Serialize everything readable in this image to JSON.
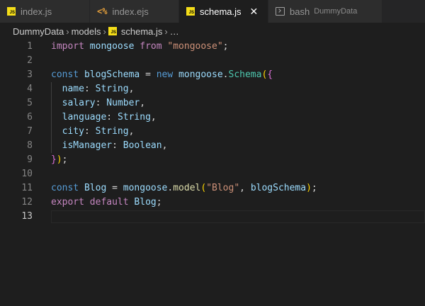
{
  "tabs": [
    {
      "label": "index.js",
      "icon": "js-icon"
    },
    {
      "label": "index.ejs",
      "icon": "ejs-icon"
    },
    {
      "label": "schema.js",
      "icon": "js-icon",
      "active": true,
      "close": "✕"
    },
    {
      "label": "bash",
      "sub": "DummyData",
      "icon": "terminal-icon"
    }
  ],
  "breadcrumb": {
    "root": "DummyData",
    "folder": "models",
    "file": "schema.js",
    "ellipsis": "…",
    "separator": "›"
  },
  "editor": {
    "line_numbers": [
      "1",
      "2",
      "3",
      "4",
      "5",
      "6",
      "7",
      "8",
      "9",
      "10",
      "11",
      "12",
      "13"
    ],
    "current_line": 13,
    "lines": [
      [
        [
          "import",
          "kw"
        ],
        [
          " ",
          ""
        ],
        [
          "mongoose",
          "var"
        ],
        [
          " ",
          ""
        ],
        [
          "from",
          "kw"
        ],
        [
          " ",
          ""
        ],
        [
          "\"mongoose\"",
          "str"
        ],
        [
          ";",
          ""
        ]
      ],
      [],
      [
        [
          "const",
          "st"
        ],
        [
          " ",
          ""
        ],
        [
          "blogSchema",
          "var"
        ],
        [
          " = ",
          ""
        ],
        [
          "new",
          "st"
        ],
        [
          " ",
          ""
        ],
        [
          "mongoose",
          "var"
        ],
        [
          ".",
          ""
        ],
        [
          "Schema",
          "cls"
        ],
        [
          "(",
          "b1"
        ],
        [
          "{",
          "b2"
        ]
      ],
      [
        [
          "  ",
          ""
        ],
        [
          "name",
          "var"
        ],
        [
          ": ",
          ""
        ],
        [
          "String",
          "var"
        ],
        [
          ",",
          ""
        ]
      ],
      [
        [
          "  ",
          ""
        ],
        [
          "salary",
          "var"
        ],
        [
          ": ",
          ""
        ],
        [
          "Number",
          "var"
        ],
        [
          ",",
          ""
        ]
      ],
      [
        [
          "  ",
          ""
        ],
        [
          "language",
          "var"
        ],
        [
          ": ",
          ""
        ],
        [
          "String",
          "var"
        ],
        [
          ",",
          ""
        ]
      ],
      [
        [
          "  ",
          ""
        ],
        [
          "city",
          "var"
        ],
        [
          ": ",
          ""
        ],
        [
          "String",
          "var"
        ],
        [
          ",",
          ""
        ]
      ],
      [
        [
          "  ",
          ""
        ],
        [
          "isManager",
          "var"
        ],
        [
          ": ",
          ""
        ],
        [
          "Boolean",
          "var"
        ],
        [
          ",",
          ""
        ]
      ],
      [
        [
          "}",
          "b2"
        ],
        [
          ")",
          "b1"
        ],
        [
          ";",
          ""
        ]
      ],
      [],
      [
        [
          "const",
          "st"
        ],
        [
          " ",
          ""
        ],
        [
          "Blog",
          "var"
        ],
        [
          " = ",
          ""
        ],
        [
          "mongoose",
          "var"
        ],
        [
          ".",
          ""
        ],
        [
          "model",
          "fn"
        ],
        [
          "(",
          "b1"
        ],
        [
          "\"Blog\"",
          "str"
        ],
        [
          ", ",
          ""
        ],
        [
          "blogSchema",
          "var"
        ],
        [
          ")",
          "b1"
        ],
        [
          ";",
          ""
        ]
      ],
      [
        [
          "export",
          "kw"
        ],
        [
          " ",
          ""
        ],
        [
          "default",
          "kw"
        ],
        [
          " ",
          ""
        ],
        [
          "Blog",
          "var"
        ],
        [
          ";",
          ""
        ]
      ],
      []
    ]
  },
  "colors": {
    "background": "#1e1e1e",
    "tabbar": "#252526",
    "keyword": "#c586c0",
    "storage": "#569cd6",
    "variable": "#9cdcfe",
    "string": "#ce9178",
    "function": "#dcdcaa",
    "class": "#4ec9b0"
  }
}
